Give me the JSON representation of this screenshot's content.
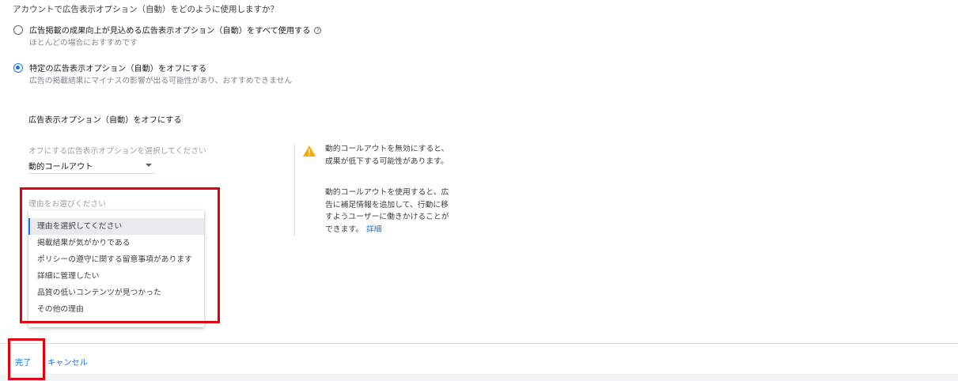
{
  "question": "アカウントで広告表示オプション（自動）をどのように使用しますか？",
  "options": [
    {
      "label": "広告掲載の成果向上が見込める広告表示オプション（自動）をすべて使用する",
      "sub": "ほとんどの場合におすすめです",
      "checked": false
    },
    {
      "label": "特定の広告表示オプション（自動）をオフにする",
      "sub": "広告の掲載結果にマイナスの影響が出る可能性があり、おすすめできません",
      "checked": true
    }
  ],
  "section_title": "広告表示オプション（自動）をオフにする",
  "select": {
    "label": "オフにする広告表示オプションを選択してください",
    "value": "動的コールアウト"
  },
  "warning": {
    "text": "動的コールアウトを無効にすると、成果が低下する可能性があります。",
    "info": "動的コールアウトを使用すると、広告に補足情報を追加して、行動に移すようユーザーに働きかけることができます。",
    "link": "詳細"
  },
  "reason": {
    "label": "理由をお選びください",
    "options": [
      "理由を選択してください",
      "掲載結果が気がかりである",
      "ポリシーの遵守に関する留意事項があります",
      "詳細に管理したい",
      "品質の低いコンテンツが見つかった",
      "その他の理由"
    ],
    "selected_index": 0
  },
  "footer": {
    "done": "完了",
    "cancel": "キャンセル"
  },
  "colors": {
    "accent": "#1a73e8",
    "warning": "#f9ab00",
    "highlight_box": "#e0000f"
  }
}
